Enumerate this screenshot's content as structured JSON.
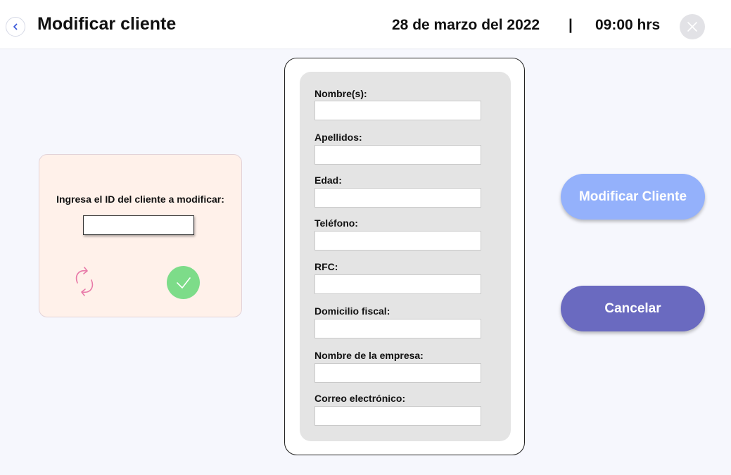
{
  "header": {
    "title": "Modificar cliente",
    "date": "28 de marzo del 2022",
    "separator": "|",
    "time": "09:00 hrs"
  },
  "id_lookup": {
    "label": "Ingresa el ID del cliente a modificar:",
    "value": "",
    "refresh_icon": "refresh-icon",
    "confirm_icon": "checkmark-icon"
  },
  "form": {
    "fields": [
      {
        "label": "Nombre(s):",
        "value": ""
      },
      {
        "label": "Apellidos:",
        "value": ""
      },
      {
        "label": "Edad:",
        "value": ""
      },
      {
        "label": "Teléfono:",
        "value": ""
      },
      {
        "label": "RFC:",
        "value": ""
      },
      {
        "label": "Domicilio fiscal:",
        "value": ""
      },
      {
        "label": "Nombre de la empresa:",
        "value": ""
      },
      {
        "label": "Correo electrónico:",
        "value": ""
      }
    ]
  },
  "actions": {
    "modify_label": "Modificar Cliente",
    "cancel_label": "Cancelar"
  },
  "colors": {
    "background": "#f6f7fd",
    "id_card": "#fff1ea",
    "confirm": "#7ddc89",
    "refresh": "#e879a8",
    "modify_button": "#94b1fb",
    "cancel_button": "#6a6ac0",
    "back_arrow": "#3d5bd9"
  }
}
